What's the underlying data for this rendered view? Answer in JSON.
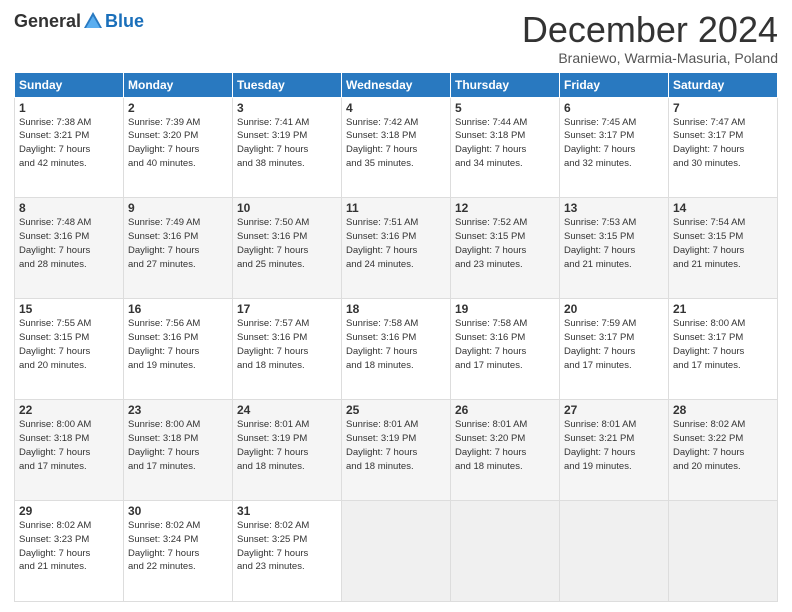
{
  "logo": {
    "general": "General",
    "blue": "Blue"
  },
  "title": "December 2024",
  "location": "Braniewo, Warmia-Masuria, Poland",
  "headers": [
    "Sunday",
    "Monday",
    "Tuesday",
    "Wednesday",
    "Thursday",
    "Friday",
    "Saturday"
  ],
  "weeks": [
    [
      {
        "day": "1",
        "sunrise": "7:38 AM",
        "sunset": "3:21 PM",
        "daylight": "7 hours and 42 minutes."
      },
      {
        "day": "2",
        "sunrise": "7:39 AM",
        "sunset": "3:20 PM",
        "daylight": "7 hours and 40 minutes."
      },
      {
        "day": "3",
        "sunrise": "7:41 AM",
        "sunset": "3:19 PM",
        "daylight": "7 hours and 38 minutes."
      },
      {
        "day": "4",
        "sunrise": "7:42 AM",
        "sunset": "3:18 PM",
        "daylight": "7 hours and 35 minutes."
      },
      {
        "day": "5",
        "sunrise": "7:44 AM",
        "sunset": "3:18 PM",
        "daylight": "7 hours and 34 minutes."
      },
      {
        "day": "6",
        "sunrise": "7:45 AM",
        "sunset": "3:17 PM",
        "daylight": "7 hours and 32 minutes."
      },
      {
        "day": "7",
        "sunrise": "7:47 AM",
        "sunset": "3:17 PM",
        "daylight": "7 hours and 30 minutes."
      }
    ],
    [
      {
        "day": "8",
        "sunrise": "7:48 AM",
        "sunset": "3:16 PM",
        "daylight": "7 hours and 28 minutes."
      },
      {
        "day": "9",
        "sunrise": "7:49 AM",
        "sunset": "3:16 PM",
        "daylight": "7 hours and 27 minutes."
      },
      {
        "day": "10",
        "sunrise": "7:50 AM",
        "sunset": "3:16 PM",
        "daylight": "7 hours and 25 minutes."
      },
      {
        "day": "11",
        "sunrise": "7:51 AM",
        "sunset": "3:16 PM",
        "daylight": "7 hours and 24 minutes."
      },
      {
        "day": "12",
        "sunrise": "7:52 AM",
        "sunset": "3:15 PM",
        "daylight": "7 hours and 23 minutes."
      },
      {
        "day": "13",
        "sunrise": "7:53 AM",
        "sunset": "3:15 PM",
        "daylight": "7 hours and 21 minutes."
      },
      {
        "day": "14",
        "sunrise": "7:54 AM",
        "sunset": "3:15 PM",
        "daylight": "7 hours and 21 minutes."
      }
    ],
    [
      {
        "day": "15",
        "sunrise": "7:55 AM",
        "sunset": "3:15 PM",
        "daylight": "7 hours and 20 minutes."
      },
      {
        "day": "16",
        "sunrise": "7:56 AM",
        "sunset": "3:16 PM",
        "daylight": "7 hours and 19 minutes."
      },
      {
        "day": "17",
        "sunrise": "7:57 AM",
        "sunset": "3:16 PM",
        "daylight": "7 hours and 18 minutes."
      },
      {
        "day": "18",
        "sunrise": "7:58 AM",
        "sunset": "3:16 PM",
        "daylight": "7 hours and 18 minutes."
      },
      {
        "day": "19",
        "sunrise": "7:58 AM",
        "sunset": "3:16 PM",
        "daylight": "7 hours and 17 minutes."
      },
      {
        "day": "20",
        "sunrise": "7:59 AM",
        "sunset": "3:17 PM",
        "daylight": "7 hours and 17 minutes."
      },
      {
        "day": "21",
        "sunrise": "8:00 AM",
        "sunset": "3:17 PM",
        "daylight": "7 hours and 17 minutes."
      }
    ],
    [
      {
        "day": "22",
        "sunrise": "8:00 AM",
        "sunset": "3:18 PM",
        "daylight": "7 hours and 17 minutes."
      },
      {
        "day": "23",
        "sunrise": "8:00 AM",
        "sunset": "3:18 PM",
        "daylight": "7 hours and 17 minutes."
      },
      {
        "day": "24",
        "sunrise": "8:01 AM",
        "sunset": "3:19 PM",
        "daylight": "7 hours and 18 minutes."
      },
      {
        "day": "25",
        "sunrise": "8:01 AM",
        "sunset": "3:19 PM",
        "daylight": "7 hours and 18 minutes."
      },
      {
        "day": "26",
        "sunrise": "8:01 AM",
        "sunset": "3:20 PM",
        "daylight": "7 hours and 18 minutes."
      },
      {
        "day": "27",
        "sunrise": "8:01 AM",
        "sunset": "3:21 PM",
        "daylight": "7 hours and 19 minutes."
      },
      {
        "day": "28",
        "sunrise": "8:02 AM",
        "sunset": "3:22 PM",
        "daylight": "7 hours and 20 minutes."
      }
    ],
    [
      {
        "day": "29",
        "sunrise": "8:02 AM",
        "sunset": "3:23 PM",
        "daylight": "7 hours and 21 minutes."
      },
      {
        "day": "30",
        "sunrise": "8:02 AM",
        "sunset": "3:24 PM",
        "daylight": "7 hours and 22 minutes."
      },
      {
        "day": "31",
        "sunrise": "8:02 AM",
        "sunset": "3:25 PM",
        "daylight": "7 hours and 23 minutes."
      },
      null,
      null,
      null,
      null
    ]
  ]
}
